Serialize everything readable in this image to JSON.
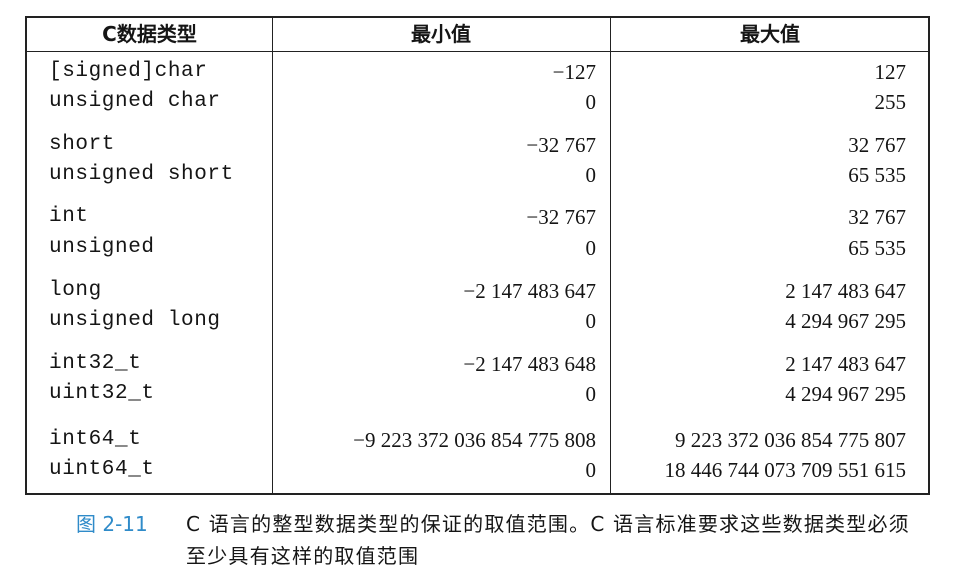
{
  "table": {
    "headers": [
      "C数据类型",
      "最小值",
      "最大值"
    ],
    "rows": [
      {
        "type": "[signed]char",
        "min": "−127",
        "max": "127"
      },
      {
        "type": "unsigned char",
        "min": "0",
        "max": "255"
      },
      {
        "type": "short",
        "min": "−32 767",
        "max": "32 767"
      },
      {
        "type": "unsigned short",
        "min": "0",
        "max": "65 535"
      },
      {
        "type": "int",
        "min": "−32 767",
        "max": "32 767"
      },
      {
        "type": "unsigned",
        "min": "0",
        "max": "65 535"
      },
      {
        "type": "long",
        "min": "−2 147 483 647",
        "max": "2 147 483 647"
      },
      {
        "type": "unsigned long",
        "min": "0",
        "max": "4 294 967 295"
      },
      {
        "type": "int32_t",
        "min": "−2 147 483 648",
        "max": "2 147 483 647"
      },
      {
        "type": "uint32_t",
        "min": "0",
        "max": "4 294 967 295"
      },
      {
        "type": "int64_t",
        "min": "−9 223 372 036 854 775 808",
        "max": "9 223 372 036 854 775 807"
      },
      {
        "type": "uint64_t",
        "min": "0",
        "max": "18 446 744 073 709 551 615"
      }
    ]
  },
  "caption": {
    "label": "图 2-11",
    "text": "C 语言的整型数据类型的保证的取值范围。C 语言标准要求这些数据类型必须至少具有这样的取值范围"
  }
}
